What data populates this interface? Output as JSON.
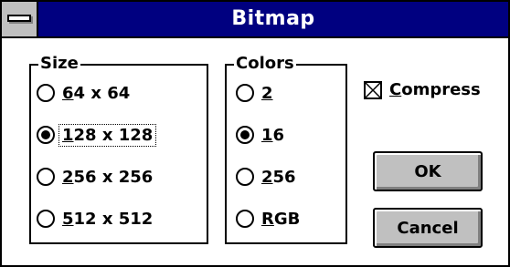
{
  "window": {
    "title": "Bitmap"
  },
  "size_group": {
    "label": "Size",
    "options": [
      {
        "mn": "6",
        "rest": "4 x 64",
        "checked": false
      },
      {
        "mn": "1",
        "rest": "28 x 128",
        "checked": true
      },
      {
        "mn": "2",
        "rest": "56 x 256",
        "checked": false
      },
      {
        "mn": "5",
        "rest": "12 x 512",
        "checked": false
      }
    ]
  },
  "colors_group": {
    "label": "Colors",
    "options": [
      {
        "mn": "2",
        "rest": "",
        "checked": false
      },
      {
        "mn": "1",
        "rest": "6",
        "checked": true
      },
      {
        "mn": "2",
        "rest": "56",
        "checked": false
      },
      {
        "mn": "R",
        "rest": "GB",
        "checked": false
      }
    ]
  },
  "compress": {
    "mn": "C",
    "rest": "ompress",
    "checked": true
  },
  "buttons": {
    "ok": "OK",
    "cancel": "Cancel"
  },
  "colors": {
    "title_bar": "#000080",
    "button_face": "#c0c0c0"
  },
  "icons": {
    "system_menu": "minus-bar-icon"
  }
}
